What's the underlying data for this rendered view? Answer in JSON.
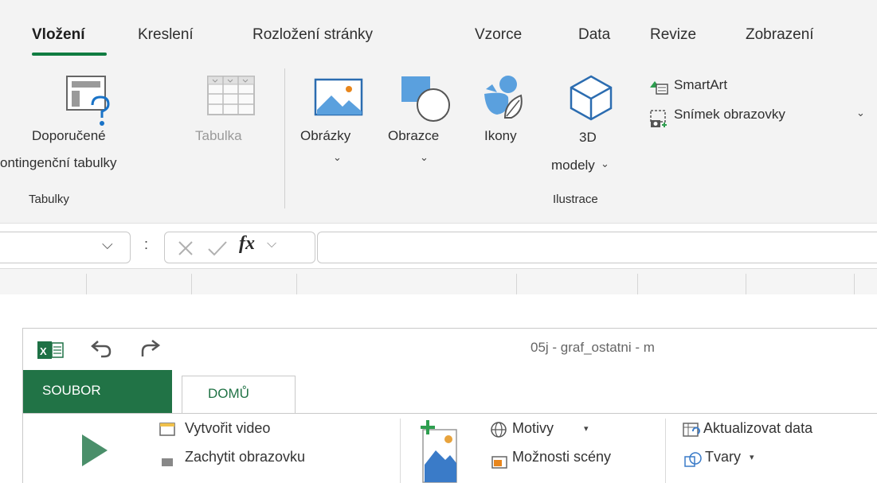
{
  "top_ribbon": {
    "tabs": [
      "Vložení",
      "Kreslení",
      "Rozložení stránky",
      "Vzorce",
      "Data",
      "Revize",
      "Zobrazení"
    ],
    "active_tab": "Vložení",
    "groups": {
      "tables": {
        "label": "Tabulky",
        "recommended_line1": "Doporučené",
        "recommended_line2": "ontingenční tabulky",
        "table": "Tabulka"
      },
      "illustrations": {
        "label": "Ilustrace",
        "pictures": "Obrázky",
        "shapes": "Obrazce",
        "icons": "Ikony",
        "models_line1": "3D",
        "models_line2": "modely",
        "smartart": "SmartArt",
        "screenshot": "Snímek obrazovky"
      }
    },
    "formula_bar": {
      "fx": "fx",
      "colon": ":"
    },
    "accent": "#107c41"
  },
  "bottom_window": {
    "title": "05j - graf_ostatni - m",
    "tabs": {
      "file": "SOUBOR",
      "home": "DOMŮ"
    },
    "buttons": {
      "create_video": "Vytvořit video",
      "capture_screen": "Zachytit obrazovku",
      "themes": "Motivy",
      "scene_options": "Možnosti scény",
      "refresh_data": "Aktualizovat data",
      "shapes": "Tvary"
    },
    "accent": "#217346"
  }
}
